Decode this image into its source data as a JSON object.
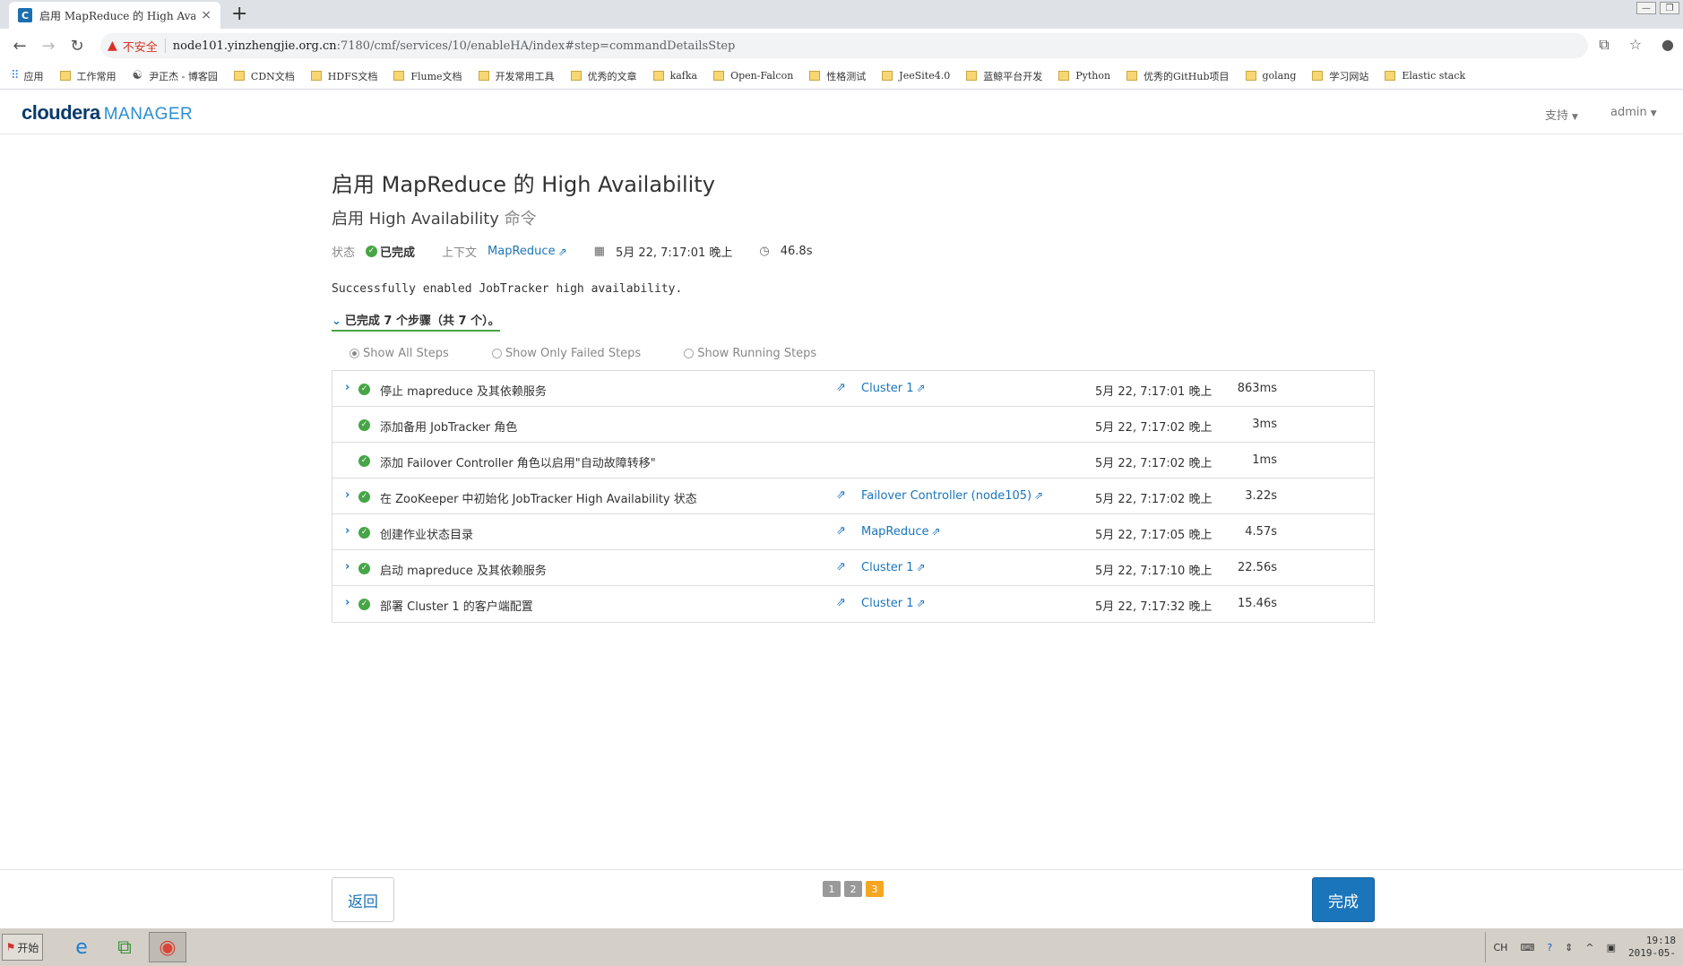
{
  "browser": {
    "tab_title": "启用 MapReduce 的 High Avail...",
    "tab_close": "×",
    "new_tab": "+",
    "insecure_label": "不安全",
    "url_host": "node101.yinzhengjie.org.cn",
    "url_path": ":7180/cmf/services/10/enableHA/index#step=commandDetailsStep",
    "bookmarks": [
      {
        "label": "应用",
        "icon": "apps-icon"
      },
      {
        "label": "工作常用",
        "icon": "folder-icon"
      },
      {
        "label": "尹正杰 - 博客园",
        "icon": "site-icon"
      },
      {
        "label": "CDN文档",
        "icon": "folder-icon"
      },
      {
        "label": "HDFS文档",
        "icon": "folder-icon"
      },
      {
        "label": "Flume文档",
        "icon": "folder-icon"
      },
      {
        "label": "开发常用工具",
        "icon": "folder-icon"
      },
      {
        "label": "优秀的文章",
        "icon": "folder-icon"
      },
      {
        "label": "kafka",
        "icon": "folder-icon"
      },
      {
        "label": "Open-Falcon",
        "icon": "folder-icon"
      },
      {
        "label": "性格测试",
        "icon": "folder-icon"
      },
      {
        "label": "JeeSite4.0",
        "icon": "folder-icon"
      },
      {
        "label": "蓝鲸平台开发",
        "icon": "folder-icon"
      },
      {
        "label": "Python",
        "icon": "folder-icon"
      },
      {
        "label": "优秀的GitHub项目",
        "icon": "folder-icon"
      },
      {
        "label": "golang",
        "icon": "folder-icon"
      },
      {
        "label": "学习网站",
        "icon": "folder-icon"
      },
      {
        "label": "Elastic stack",
        "icon": "folder-icon"
      }
    ]
  },
  "header": {
    "logo_main": "cloudera",
    "logo_sub": "MANAGER",
    "support": "支持",
    "user": "admin"
  },
  "page": {
    "title": "启用 MapReduce 的 High Availability",
    "subtitle_main": "启用 High Availability",
    "subtitle_muted": "命令",
    "status_label": "状态",
    "status_value": "已完成",
    "context_label": "上下文",
    "context_value": "MapReduce",
    "started": "5月 22, 7:17:01 晚上",
    "duration": "46.8s",
    "success_message": "Successfully enabled JobTracker high availability.",
    "steps_summary": "已完成 7 个步骤（共 7 个）。",
    "filters": [
      "Show All Steps",
      "Show Only Failed Steps",
      "Show Running Steps"
    ],
    "selected_filter": "Show All Steps"
  },
  "steps": [
    {
      "name": "停止 mapreduce 及其依赖服务",
      "context": "Cluster 1",
      "time": "5月 22, 7:17:01 晚上",
      "duration": "863ms",
      "expandable": true
    },
    {
      "name": "添加备用 JobTracker 角色",
      "context": "",
      "time": "5月 22, 7:17:02 晚上",
      "duration": "3ms",
      "expandable": false
    },
    {
      "name": "添加 Failover Controller 角色以启用\"自动故障转移\"",
      "context": "",
      "time": "5月 22, 7:17:02 晚上",
      "duration": "1ms",
      "expandable": false
    },
    {
      "name": "在 ZooKeeper 中初始化 JobTracker High Availability 状态",
      "context": "Failover Controller (node105)",
      "time": "5月 22, 7:17:02 晚上",
      "duration": "3.22s",
      "expandable": true
    },
    {
      "name": "创建作业状态目录",
      "context": "MapReduce",
      "time": "5月 22, 7:17:05 晚上",
      "duration": "4.57s",
      "expandable": true
    },
    {
      "name": "启动 mapreduce 及其依赖服务",
      "context": "Cluster 1",
      "time": "5月 22, 7:17:10 晚上",
      "duration": "22.56s",
      "expandable": true
    },
    {
      "name": "部署 Cluster 1 的客户端配置",
      "context": "Cluster 1",
      "time": "5月 22, 7:17:32 晚上",
      "duration": "15.46s",
      "expandable": true
    }
  ],
  "footer": {
    "back": "返回",
    "pages": [
      "1",
      "2",
      "3"
    ],
    "current_page": "3",
    "finish": "完成"
  },
  "taskbar": {
    "start": "开始",
    "lang": "CH",
    "time": "19:18",
    "date": "2019-05-"
  },
  "colors": {
    "accent": "#1b75bb",
    "success": "#46a546",
    "pager_active": "#f5a623"
  }
}
